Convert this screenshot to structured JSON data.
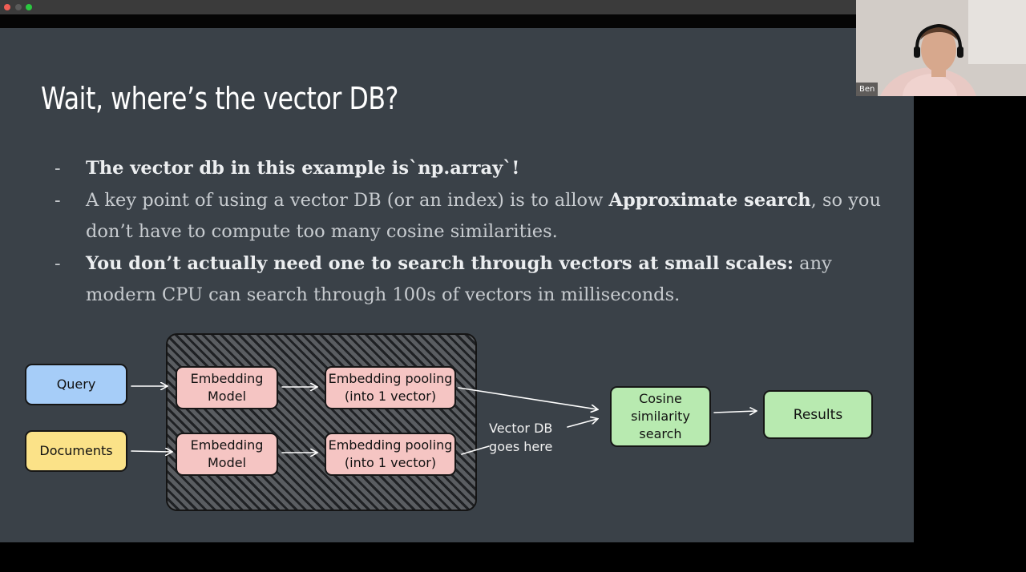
{
  "slide": {
    "title": "Wait, where’s the vector DB?",
    "bullets": [
      {
        "dash": "-",
        "bold": "The vector db in this example is`np.array`!",
        "rest": ""
      },
      {
        "dash": "-",
        "pre": "A key point of using a vector DB (or an index) is to allow ",
        "bold": "Approximate search",
        "rest": ", so you don’t have to compute too many cosine similarities."
      },
      {
        "dash": "-",
        "bold": "You don’t actually need one to search through vectors at small scales:",
        "rest": " any modern CPU can search through 100s of vectors in milliseconds."
      }
    ]
  },
  "diagram": {
    "query": "Query",
    "documents": "Documents",
    "embedding_model_1": "Embedding\nModel",
    "embedding_model_2": "Embedding\nModel",
    "pooling_1": "Embedding pooling\n(into 1 vector)",
    "pooling_2": "Embedding pooling\n(into 1 vector)",
    "vector_db_label": "Vector DB\ngoes here",
    "cosine": "Cosine\nsimilarity\nsearch",
    "results": "Results"
  },
  "participant": {
    "name": "Ben"
  },
  "colors": {
    "slide_bg": "#3a4148",
    "query": "#a6cdf8",
    "documents": "#fbe288",
    "embedding": "#f5c5c3",
    "search": "#b8eab0"
  }
}
